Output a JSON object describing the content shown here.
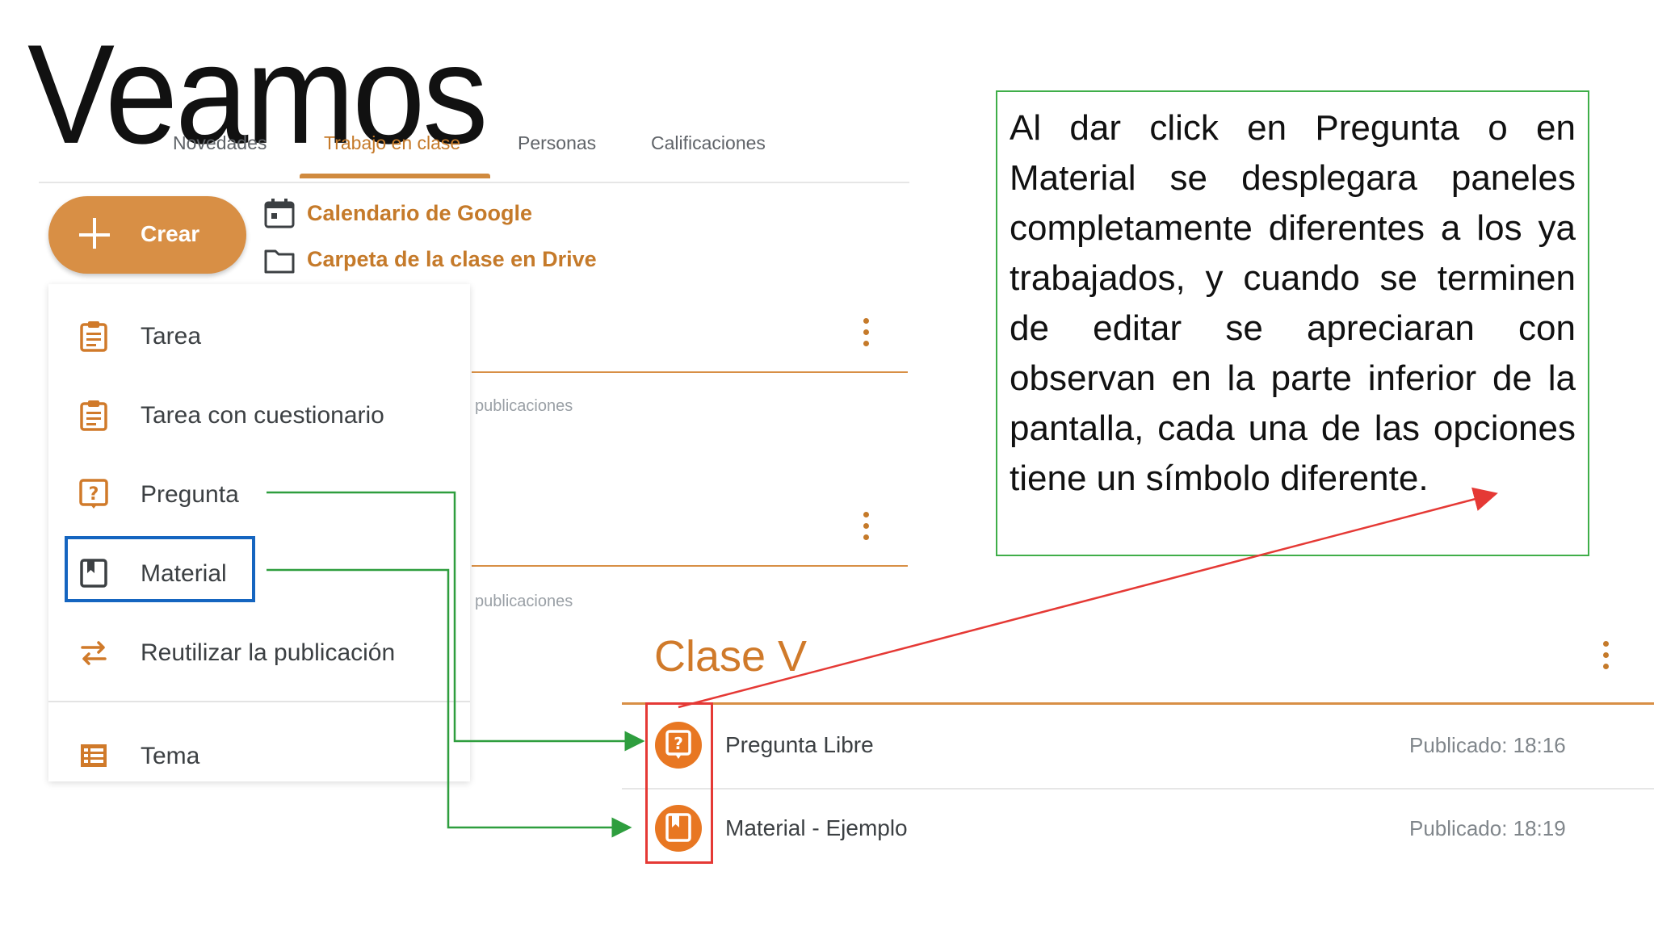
{
  "slide": {
    "title": "Veamos"
  },
  "tabs": [
    "Novedades",
    "Trabajo en clase",
    "Personas",
    "Calificaciones"
  ],
  "active_tab": "Trabajo en clase",
  "create_button": {
    "label": "Crear"
  },
  "quick_links": {
    "calendar": "Calendario de Google",
    "drive": "Carpeta de la clase en Drive"
  },
  "create_menu": {
    "tarea": "Tarea",
    "tarea_cuestionario": "Tarea con cuestionario",
    "pregunta": "Pregunta",
    "material": "Material",
    "reutilizar": "Reutilizar la publicación",
    "tema": "Tema"
  },
  "background_rows": {
    "label": "publicaciones"
  },
  "clase_panel": {
    "title": "Clase V",
    "posts": [
      {
        "title": "Pregunta Libre",
        "time": "Publicado: 18:16"
      },
      {
        "title": "Material - Ejemplo",
        "time": "Publicado: 18:19"
      }
    ]
  },
  "explanation": "Al dar click en Pregunta o en Material se desplegara paneles completamente diferentes a los ya trabajados, y cuando se terminen de editar se apreciaran con observan en la parte inferior de la pantalla, cada una de las opciones tiene un símbolo diferente.",
  "colors": {
    "accent_orange": "#d88f45",
    "icon_orange": "#e87722",
    "highlight_blue": "#1565c0",
    "connector_green": "#2e9e3e",
    "arrow_red": "#e53935"
  }
}
